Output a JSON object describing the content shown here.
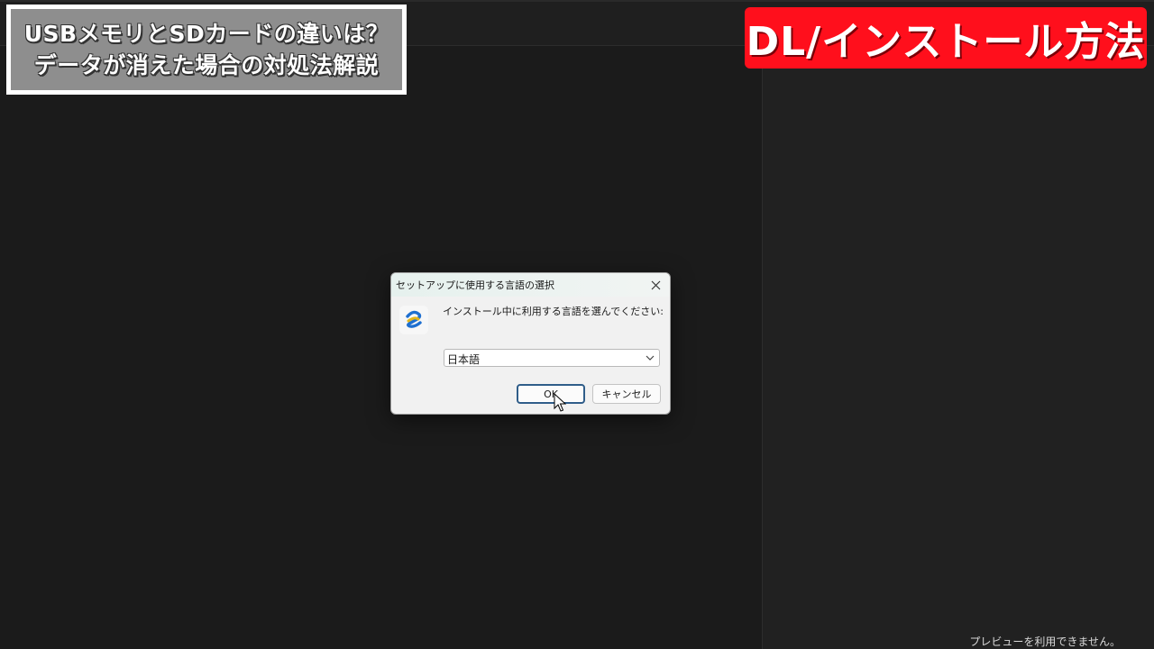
{
  "caption_left": {
    "line1": "USBメモリとSDカードの違いは？",
    "line2": "データが消えた場合の対処法解説"
  },
  "caption_right": {
    "text": "DL/インストール方法"
  },
  "dialog": {
    "title": "セットアップに使用する言語の選択",
    "prompt": "インストール中に利用する言語を選んでください:",
    "language_select": {
      "selected": "日本語"
    },
    "ok_label": "OK",
    "cancel_label": "キャンセル",
    "icons": {
      "close": "close-icon",
      "app": "setup-app-icon",
      "dropdown": "chevron-down-icon"
    }
  },
  "right_pane": {
    "preview_message": "プレビューを利用できません。"
  },
  "colors": {
    "caption_right_bg": "#ff0f1c",
    "caption_left_bg": "#8e8e8e",
    "background": "#1b1b1b",
    "ok_border": "#2f5d89"
  }
}
